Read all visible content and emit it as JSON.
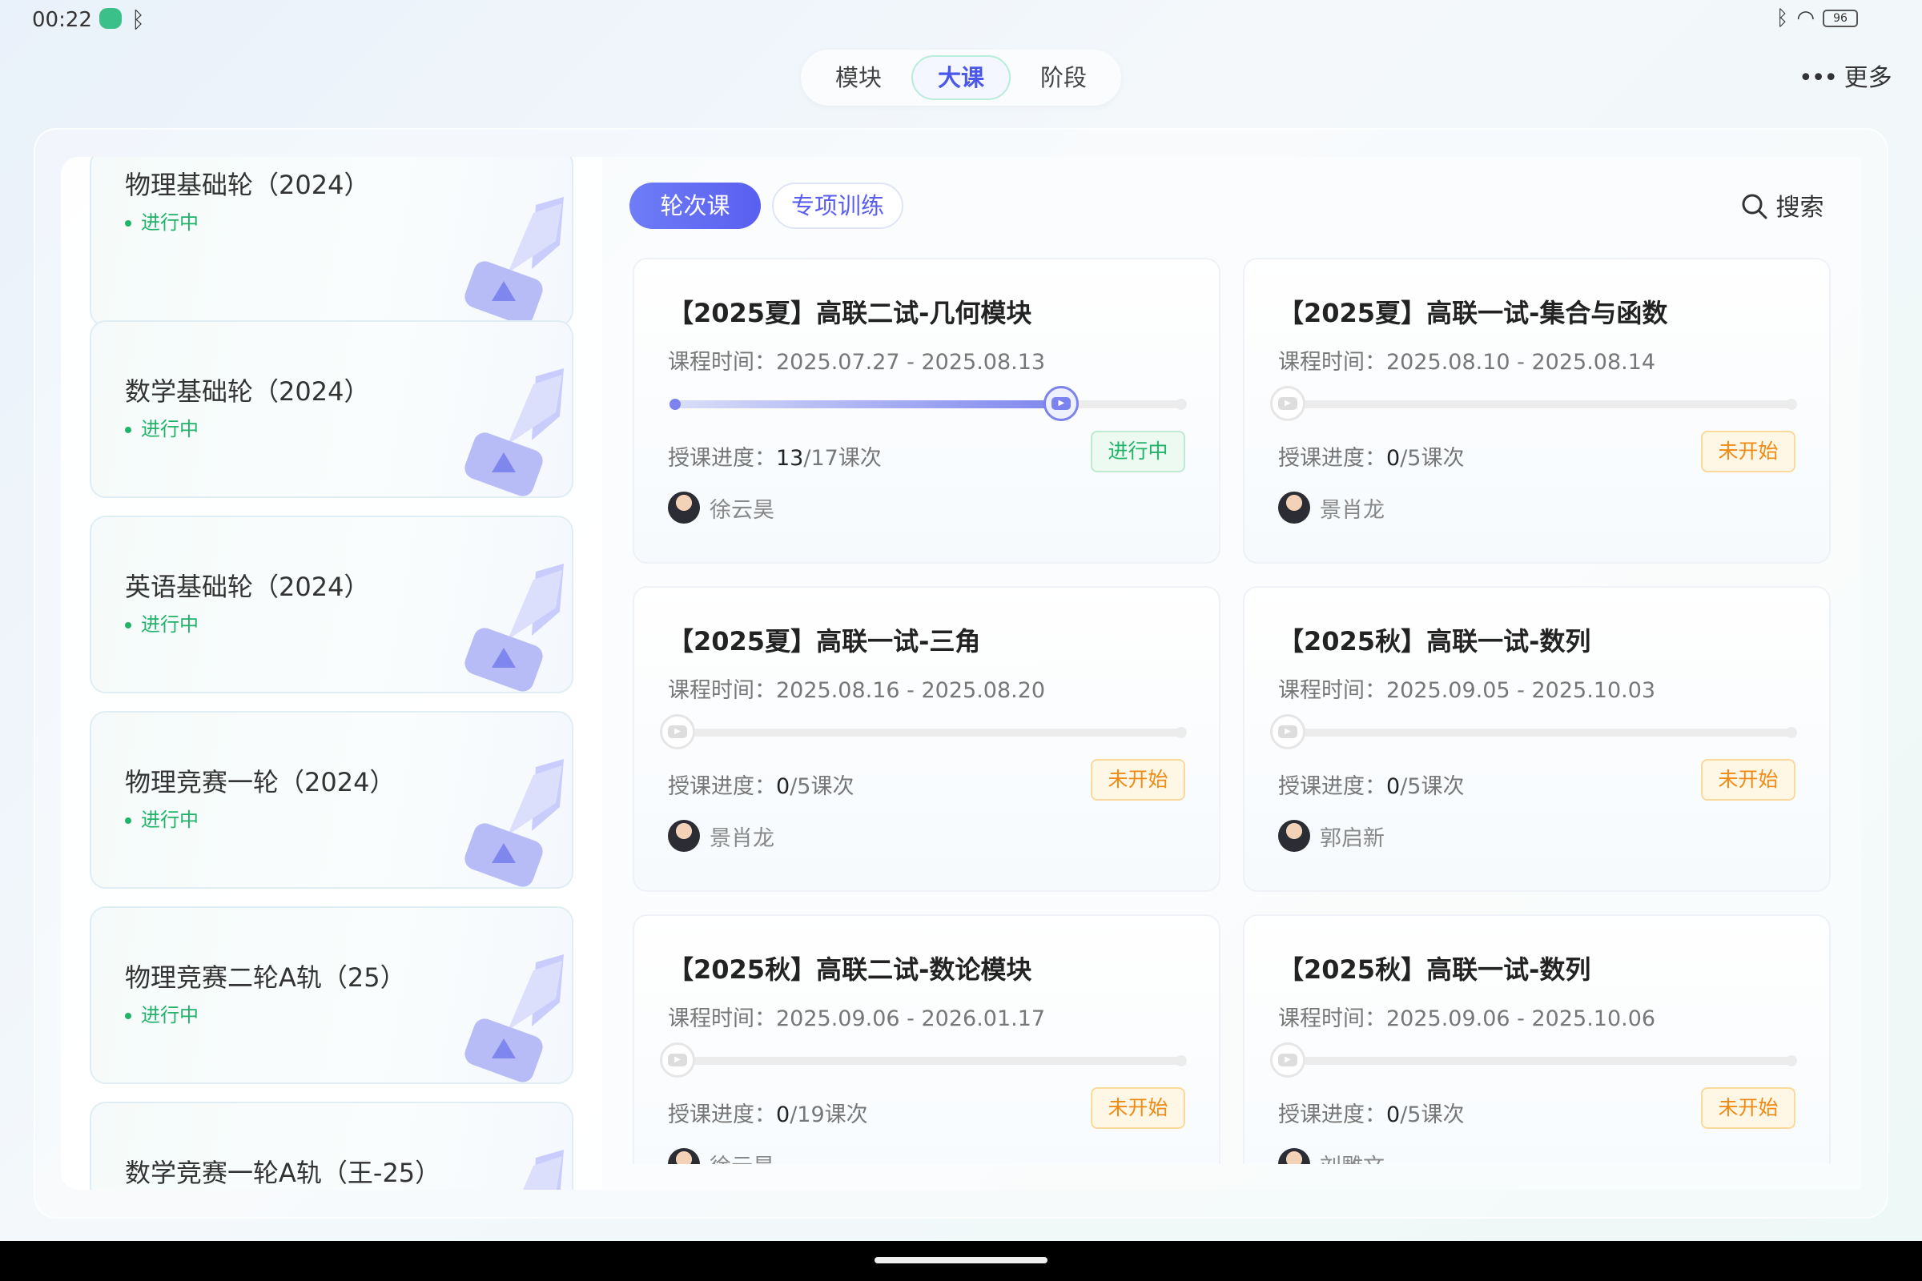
{
  "status": {
    "time": "00:22",
    "battery": "96"
  },
  "top_tabs": [
    "模块",
    "大课",
    "阶段"
  ],
  "top_tab_active": "大课",
  "more_label": "更多",
  "sidebar": [
    {
      "title": "物理基础轮（2024）",
      "status": "进行中"
    },
    {
      "title": "数学基础轮（2024）",
      "status": "进行中"
    },
    {
      "title": "英语基础轮（2024）",
      "status": "进行中"
    },
    {
      "title": "物理竞赛一轮（2024）",
      "status": "进行中"
    },
    {
      "title": "物理竞赛二轮A轨（25）",
      "status": "进行中"
    },
    {
      "title": "数学竞赛一轮A轨（王-25）",
      "status": ""
    }
  ],
  "filter_tabs": [
    "轮次课",
    "专项训练"
  ],
  "search_label": "搜索",
  "labels": {
    "time_prefix": "课程时间：",
    "progress_prefix": "授课进度：",
    "unit": "课次"
  },
  "courses": [
    {
      "title": "【2025夏】高联二试-几何模块",
      "time": "2025.07.27 - 2025.08.13",
      "done": "13",
      "total": "/17",
      "progress": 0.76,
      "status": "进行中",
      "status_type": "in_progress",
      "teacher": "徐云昊"
    },
    {
      "title": "【2025夏】高联一试-集合与函数",
      "time": "2025.08.10 - 2025.08.14",
      "done": "0",
      "total": "/5",
      "progress": 0,
      "status": "未开始",
      "status_type": "not_started",
      "teacher": "景肖龙"
    },
    {
      "title": "【2025夏】高联一试-三角",
      "time": "2025.08.16 - 2025.08.20",
      "done": "0",
      "total": "/5",
      "progress": 0,
      "status": "未开始",
      "status_type": "not_started",
      "teacher": "景肖龙"
    },
    {
      "title": "【2025秋】高联一试-数列",
      "time": "2025.09.05 - 2025.10.03",
      "done": "0",
      "total": "/5",
      "progress": 0,
      "status": "未开始",
      "status_type": "not_started",
      "teacher": "郭启新"
    },
    {
      "title": "【2025秋】高联二试-数论模块",
      "time": "2025.09.06 - 2026.01.17",
      "done": "0",
      "total": "/19",
      "progress": 0,
      "status": "未开始",
      "status_type": "not_started",
      "teacher": "徐云昊"
    },
    {
      "title": "【2025秋】高联一试-数列",
      "time": "2025.09.06 - 2025.10.06",
      "done": "0",
      "total": "/5",
      "progress": 0,
      "status": "未开始",
      "status_type": "not_started",
      "teacher": "刘雕文"
    }
  ]
}
